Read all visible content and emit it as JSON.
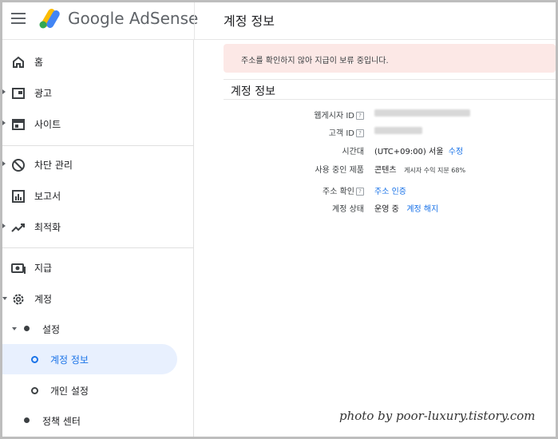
{
  "header": {
    "app_name": "Google AdSense",
    "page_title": "계정 정보"
  },
  "sidebar": {
    "items": [
      {
        "label": "홈",
        "icon": "home-icon"
      },
      {
        "label": "광고",
        "icon": "ads-icon"
      },
      {
        "label": "사이트",
        "icon": "sites-icon"
      },
      {
        "label": "차단 관리",
        "icon": "block-icon"
      },
      {
        "label": "보고서",
        "icon": "reports-icon"
      },
      {
        "label": "최적화",
        "icon": "optimization-icon"
      },
      {
        "label": "지급",
        "icon": "payments-icon"
      },
      {
        "label": "계정",
        "icon": "gear-icon"
      },
      {
        "label": "설정"
      },
      {
        "label": "계정 정보"
      },
      {
        "label": "개인 설정"
      },
      {
        "label": "정책 센터"
      }
    ],
    "active_item": "계정 정보"
  },
  "banner": {
    "message": "주소를 확인하지 않아 지급이 보류 중입니다."
  },
  "account": {
    "section_title": "계정 정보",
    "publisher_id_label": "웹게시자 ID",
    "customer_id_label": "고객 ID",
    "timezone_label": "시간대",
    "timezone_value": "(UTC+09:00) 서울",
    "timezone_edit": "수정",
    "products_label": "사용 중인 제품",
    "products_value": "콘텐츠",
    "products_share": "게시자 수익 지분 68%",
    "address_label": "주소 확인",
    "address_link": "주소 인증",
    "status_label": "계정 상태",
    "status_value": "운영 중",
    "status_link": "계정 해지"
  },
  "watermark": "photo by poor-luxury.tistory.com",
  "colors": {
    "accent": "#1a73e8",
    "banner_bg": "#fce8e6",
    "active_bg": "#e8f0fe"
  }
}
